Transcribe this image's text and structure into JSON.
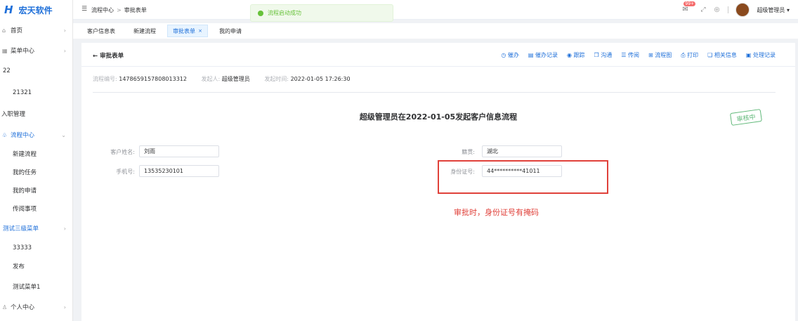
{
  "brand": {
    "logo": "H",
    "name": "宏天软件"
  },
  "sidebar": {
    "items": [
      {
        "label": "首页",
        "icon": "home-icon",
        "chevron": true
      },
      {
        "label": "菜单中心",
        "icon": "grid-icon",
        "chevron": true
      },
      {
        "label": "22"
      },
      {
        "label": "21321"
      },
      {
        "label": "入职管理"
      },
      {
        "label": "流程中心",
        "icon": "process-icon",
        "chevron": true,
        "active": true
      },
      {
        "label": "新建流程"
      },
      {
        "label": "我的任务"
      },
      {
        "label": "我的申请"
      },
      {
        "label": "传阅事项"
      },
      {
        "label": "测试三级菜单",
        "chevron": true,
        "active": true
      },
      {
        "label": "33333"
      },
      {
        "label": "发布"
      },
      {
        "label": "测试菜单1"
      },
      {
        "label": "个人中心",
        "icon": "user-icon",
        "chevron": true
      }
    ]
  },
  "header": {
    "breadcrumb": [
      "流程中心",
      "审批表单"
    ],
    "toast": "流程启动成功",
    "badge": "99+",
    "user": "超级管理员",
    "user_caret": "▾"
  },
  "tabs": [
    {
      "label": "客户信息表"
    },
    {
      "label": "新建流程"
    },
    {
      "label": "审批表单",
      "active": true
    },
    {
      "label": "我的申请"
    }
  ],
  "card": {
    "back_label": "审批表单",
    "actions": [
      {
        "label": "催办",
        "icon": "clock-icon"
      },
      {
        "label": "催办记录",
        "icon": "list-icon"
      },
      {
        "label": "跟踪",
        "icon": "track-icon"
      },
      {
        "label": "沟通",
        "icon": "chat-icon"
      },
      {
        "label": "传阅",
        "icon": "share-icon"
      },
      {
        "label": "流程图",
        "icon": "flow-icon"
      },
      {
        "label": "打印",
        "icon": "print-icon"
      },
      {
        "label": "相关信息",
        "icon": "info-icon"
      },
      {
        "label": "处理记录",
        "icon": "record-icon"
      }
    ],
    "meta": {
      "no_label": "流程编号:",
      "no_value": "1478659157808013312",
      "initiator_label": "发起人:",
      "initiator_value": "超级管理员",
      "time_label": "发起时间:",
      "time_value": "2022-01-05 17:26:30"
    },
    "form_title": "超级管理员在2022-01-05发起客户信息流程",
    "stamp": "审核中",
    "fields": {
      "name_label": "客户姓名:",
      "name_value": "刘雨",
      "origin_label": "籍贯:",
      "origin_value": "湖北",
      "phone_label": "手机号:",
      "phone_value": "13535230101",
      "id_label": "身份证号:",
      "id_value": "44**********41011"
    },
    "annotation": "审批时，身份证号有掩码"
  }
}
